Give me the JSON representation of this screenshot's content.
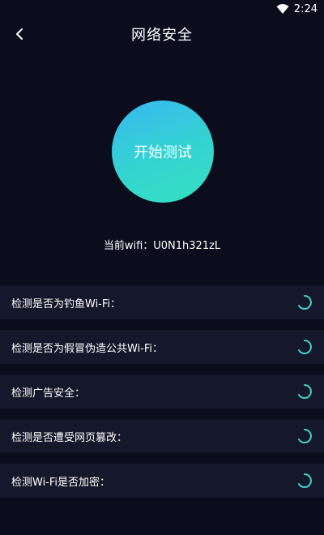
{
  "status": {
    "time": "2:24"
  },
  "header": {
    "title": "网络安全"
  },
  "main": {
    "start_button": "开始测试",
    "current_wifi": "当前wifi：U0N1h321zL"
  },
  "checks": [
    {
      "label": "检测是否为钓鱼Wi-Fi："
    },
    {
      "label": "检测是否为假冒伪造公共Wi-Fi："
    },
    {
      "label": "检测广告安全："
    },
    {
      "label": "检测是否遭受网页篡改："
    },
    {
      "label": "检测Wi-Fi是否加密："
    }
  ],
  "colors": {
    "background": "#0b0c1c",
    "row_background": "#15172a",
    "accent_start": "#38b8f0",
    "accent_end": "#34e1c2",
    "spinner": "#3fd2c8"
  },
  "icons": {
    "status_wifi": "wifi-icon",
    "back": "chevron-left-icon",
    "row_status": "loading-spinner-icon"
  }
}
